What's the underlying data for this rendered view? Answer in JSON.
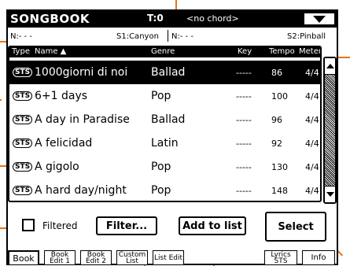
{
  "header": {
    "title": "SONGBOOK",
    "tempo": "T:0",
    "chord": "<no chord>",
    "menu_icon": "menu-arrow-icon"
  },
  "info_row": {
    "left_pad": "N:- - -",
    "style1": "S1:Canyon",
    "right_pad": "N:- - -",
    "style2": "S2:Pinball"
  },
  "list": {
    "columns": {
      "type": "Type",
      "name": "Name ▲",
      "genre": "Genre",
      "key": "Key",
      "tempo": "Tempo",
      "meter": "Meter"
    },
    "rows": [
      {
        "type": "STS",
        "name": "1000giorni di noi",
        "genre": "Ballad",
        "key": "-----",
        "tempo": "86",
        "meter": "4/4",
        "selected": true
      },
      {
        "type": "STS",
        "name": "6+1 days",
        "genre": "Pop",
        "key": "-----",
        "tempo": "100",
        "meter": "4/4",
        "selected": false
      },
      {
        "type": "STS",
        "name": "A day in Paradise",
        "genre": "Ballad",
        "key": "-----",
        "tempo": "96",
        "meter": "4/4",
        "selected": false
      },
      {
        "type": "STS",
        "name": "A felicidad",
        "genre": "Latin",
        "key": "-----",
        "tempo": "92",
        "meter": "4/4",
        "selected": false
      },
      {
        "type": "STS",
        "name": "A gigolo",
        "genre": "Pop",
        "key": "-----",
        "tempo": "130",
        "meter": "4/4",
        "selected": false
      },
      {
        "type": "STS",
        "name": "A hard day/night",
        "genre": "Pop",
        "key": "-----",
        "tempo": "148",
        "meter": "4/4",
        "selected": false
      }
    ]
  },
  "scrollbar": {
    "up_icon": "scroll-up-icon",
    "down_icon": "scroll-down-icon"
  },
  "controls": {
    "filtered_label": "Filtered",
    "filtered_checked": false,
    "filter_button": "Filter...",
    "add_to_list_button": "Add to list",
    "select_button": "Select"
  },
  "tabs": [
    {
      "label": "Book",
      "active": true
    },
    {
      "label": "Book Edit 1",
      "active": false
    },
    {
      "label": "Book Edit 2",
      "active": false
    },
    {
      "label": "Custom List",
      "active": false
    },
    {
      "label": "List Edit",
      "active": false
    },
    {
      "label": "Lyrics STS",
      "active": false
    },
    {
      "label": "Info",
      "active": false
    }
  ],
  "colors": {
    "callout": "#e8731a",
    "foreground": "#000000",
    "background": "#ffffff"
  }
}
